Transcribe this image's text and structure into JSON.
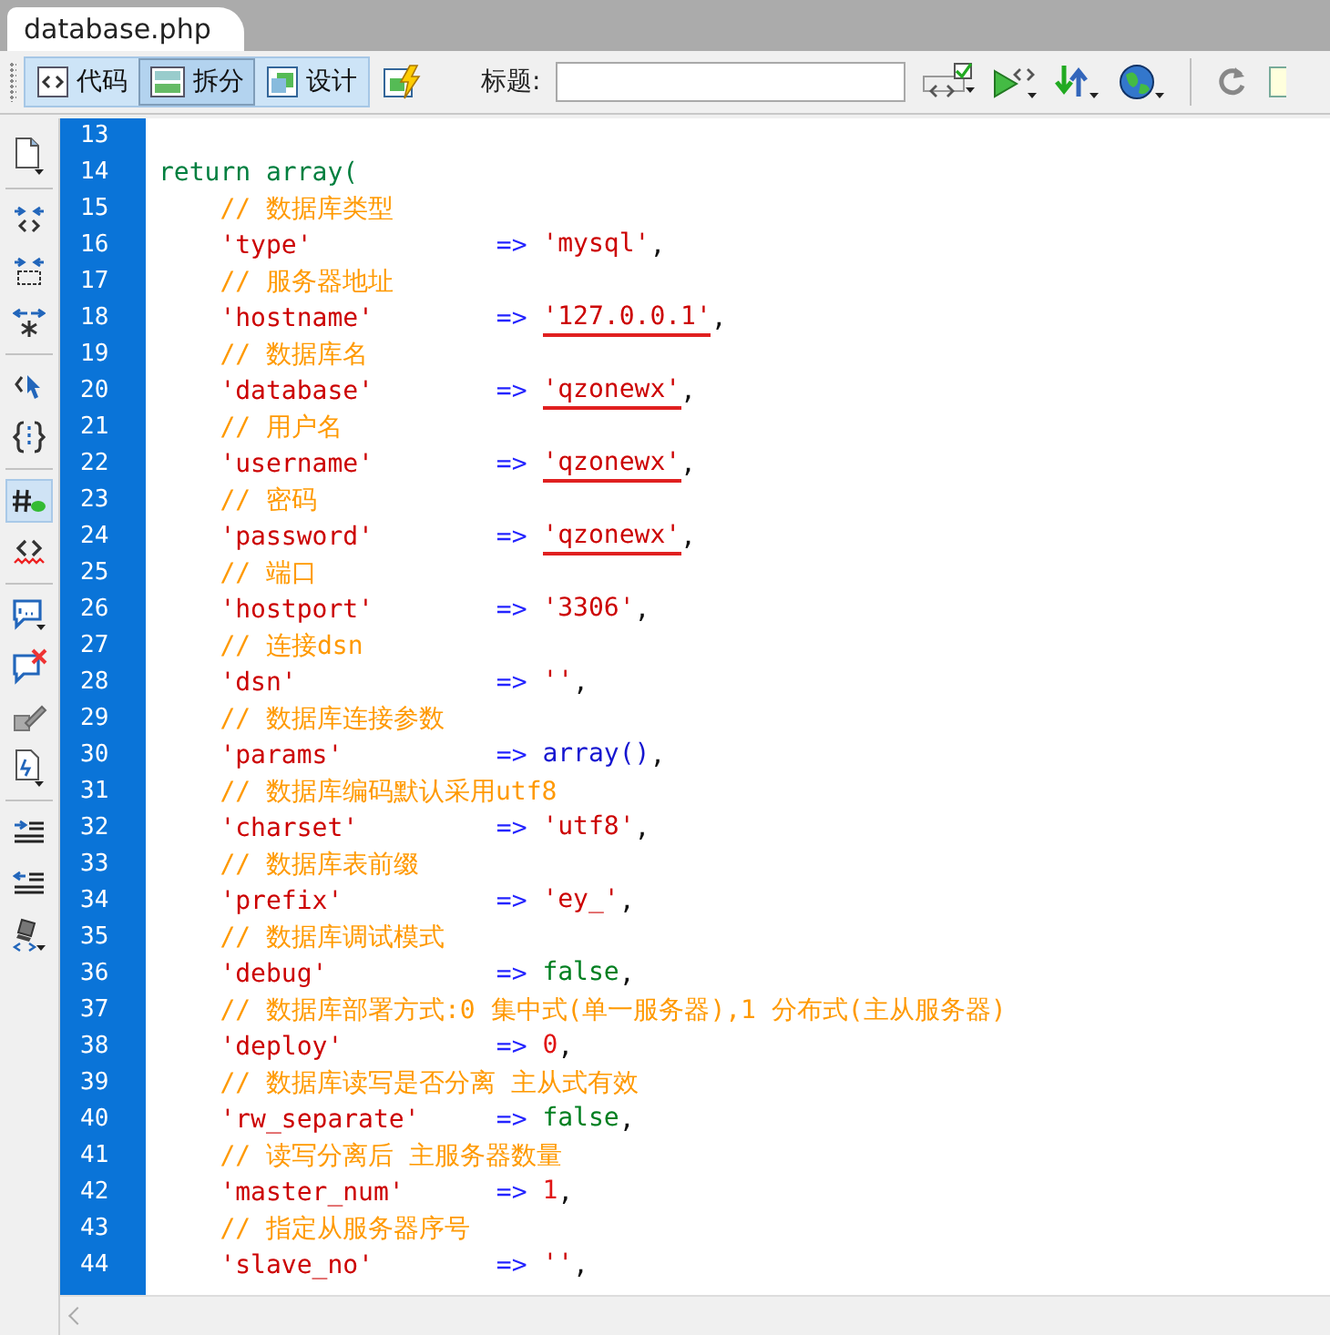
{
  "document_tab": {
    "title": "database.php",
    "selected": true
  },
  "toolbar": {
    "view_buttons": [
      {
        "kind": "code",
        "label": "代码",
        "selected": false
      },
      {
        "kind": "split",
        "label": "拆分",
        "selected": true
      },
      {
        "kind": "design",
        "label": "设计",
        "selected": false
      },
      {
        "kind": "live",
        "selected": false
      }
    ],
    "title_label": "标题:",
    "title_field": {
      "kind": "text"
    },
    "tools": [
      {
        "kind": "validate"
      },
      {
        "kind": "preview"
      },
      {
        "kind": "transfer"
      },
      {
        "kind": "globe"
      },
      {
        "kind": "divider"
      },
      {
        "kind": "refresh"
      },
      {
        "kind": "doc"
      }
    ]
  },
  "side_tools": [
    {
      "kind": "file",
      "on": false
    },
    {
      "kind": "divider"
    },
    {
      "kind": "collapse-tag",
      "on": false
    },
    {
      "kind": "collapse-sel",
      "on": false
    },
    {
      "kind": "expand",
      "on": false
    },
    {
      "kind": "divider"
    },
    {
      "kind": "select-parent",
      "on": false
    },
    {
      "kind": "braces",
      "on": false
    },
    {
      "kind": "divider"
    },
    {
      "kind": "line-numbers",
      "on": true
    },
    {
      "kind": "invalid",
      "on": false
    },
    {
      "kind": "divider"
    },
    {
      "kind": "comment",
      "on": false
    },
    {
      "kind": "uncomment",
      "on": false
    },
    {
      "kind": "wrap",
      "on": false
    },
    {
      "kind": "snippet",
      "on": false
    },
    {
      "kind": "divider"
    },
    {
      "kind": "indent",
      "on": false
    },
    {
      "kind": "outdent",
      "on": false
    },
    {
      "kind": "format",
      "on": false
    }
  ],
  "lines": [
    {
      "number": "13"
    },
    {
      "number": "14",
      "code": {
        "kind": "keyword",
        "text": "return array("
      }
    },
    {
      "number": "15",
      "comment": "// 数据库类型"
    },
    {
      "number": "16",
      "key": "'type'",
      "arrow": "=>",
      "value": {
        "kind": "string",
        "text": "'mysql'",
        "underlined": false
      },
      "end": ","
    },
    {
      "number": "17",
      "comment": "// 服务器地址"
    },
    {
      "number": "18",
      "key": "'hostname'",
      "arrow": "=>",
      "value": {
        "kind": "string",
        "text": "'127.0.0.1'",
        "underlined": true
      },
      "end": ","
    },
    {
      "number": "19",
      "comment": "// 数据库名"
    },
    {
      "number": "20",
      "key": "'database'",
      "arrow": "=>",
      "value": {
        "kind": "string",
        "text": "'qzonewx'",
        "underlined": true
      },
      "end": ","
    },
    {
      "number": "21",
      "comment": "// 用户名"
    },
    {
      "number": "22",
      "key": "'username'",
      "arrow": "=>",
      "value": {
        "kind": "string",
        "text": "'qzonewx'",
        "underlined": true
      },
      "end": ","
    },
    {
      "number": "23",
      "comment": "// 密码"
    },
    {
      "number": "24",
      "key": "'password'",
      "arrow": "=>",
      "value": {
        "kind": "string",
        "text": "'qzonewx'",
        "underlined": true
      },
      "end": ","
    },
    {
      "number": "25",
      "comment": "// 端口"
    },
    {
      "number": "26",
      "key": "'hostport'",
      "arrow": "=>",
      "value": {
        "kind": "string",
        "text": "'3306'",
        "underlined": false
      },
      "end": ","
    },
    {
      "number": "27",
      "comment": "// 连接dsn"
    },
    {
      "number": "28",
      "key": "'dsn'",
      "arrow": "=>",
      "value": {
        "kind": "string",
        "text": "''",
        "underlined": false
      },
      "end": ","
    },
    {
      "number": "29",
      "comment": "// 数据库连接参数"
    },
    {
      "number": "30",
      "key": "'params'",
      "arrow": "=>",
      "value": {
        "kind": "function",
        "text": "array()",
        "underlined": false
      },
      "end": ","
    },
    {
      "number": "31",
      "comment": "// 数据库编码默认采用utf8"
    },
    {
      "number": "32",
      "key": "'charset'",
      "arrow": "=>",
      "value": {
        "kind": "string",
        "text": "'utf8'",
        "underlined": false
      },
      "end": ","
    },
    {
      "number": "33",
      "comment": "// 数据库表前缀"
    },
    {
      "number": "34",
      "key": "'prefix'",
      "arrow": "=>",
      "value": {
        "kind": "string",
        "text": "'ey_'",
        "underlined": false
      },
      "end": ","
    },
    {
      "number": "35",
      "comment": "// 数据库调试模式"
    },
    {
      "number": "36",
      "key": "'debug'",
      "arrow": "=>",
      "value": {
        "kind": "boolean",
        "text": "false",
        "underlined": false
      },
      "end": ","
    },
    {
      "number": "37",
      "comment": "// 数据库部署方式:0 集中式(单一服务器),1 分布式(主从服务器)"
    },
    {
      "number": "38",
      "key": "'deploy'",
      "arrow": "=>",
      "value": {
        "kind": "number",
        "text": "0",
        "underlined": false
      },
      "end": ","
    },
    {
      "number": "39",
      "comment": "// 数据库读写是否分离 主从式有效"
    },
    {
      "number": "40",
      "key": "'rw_separate'",
      "arrow": "=>",
      "value": {
        "kind": "boolean",
        "text": "false",
        "underlined": false
      },
      "end": ","
    },
    {
      "number": "41",
      "comment": "// 读写分离后 主服务器数量"
    },
    {
      "number": "42",
      "key": "'master_num'",
      "arrow": "=>",
      "value": {
        "kind": "number",
        "text": "1",
        "underlined": false
      },
      "end": ","
    },
    {
      "number": "43",
      "comment": "// 指定从服务器序号"
    },
    {
      "number": "44",
      "key": "'slave_no'",
      "arrow": "=>",
      "value": {
        "kind": "string",
        "text": "''",
        "underlined": false
      },
      "end": ","
    }
  ]
}
